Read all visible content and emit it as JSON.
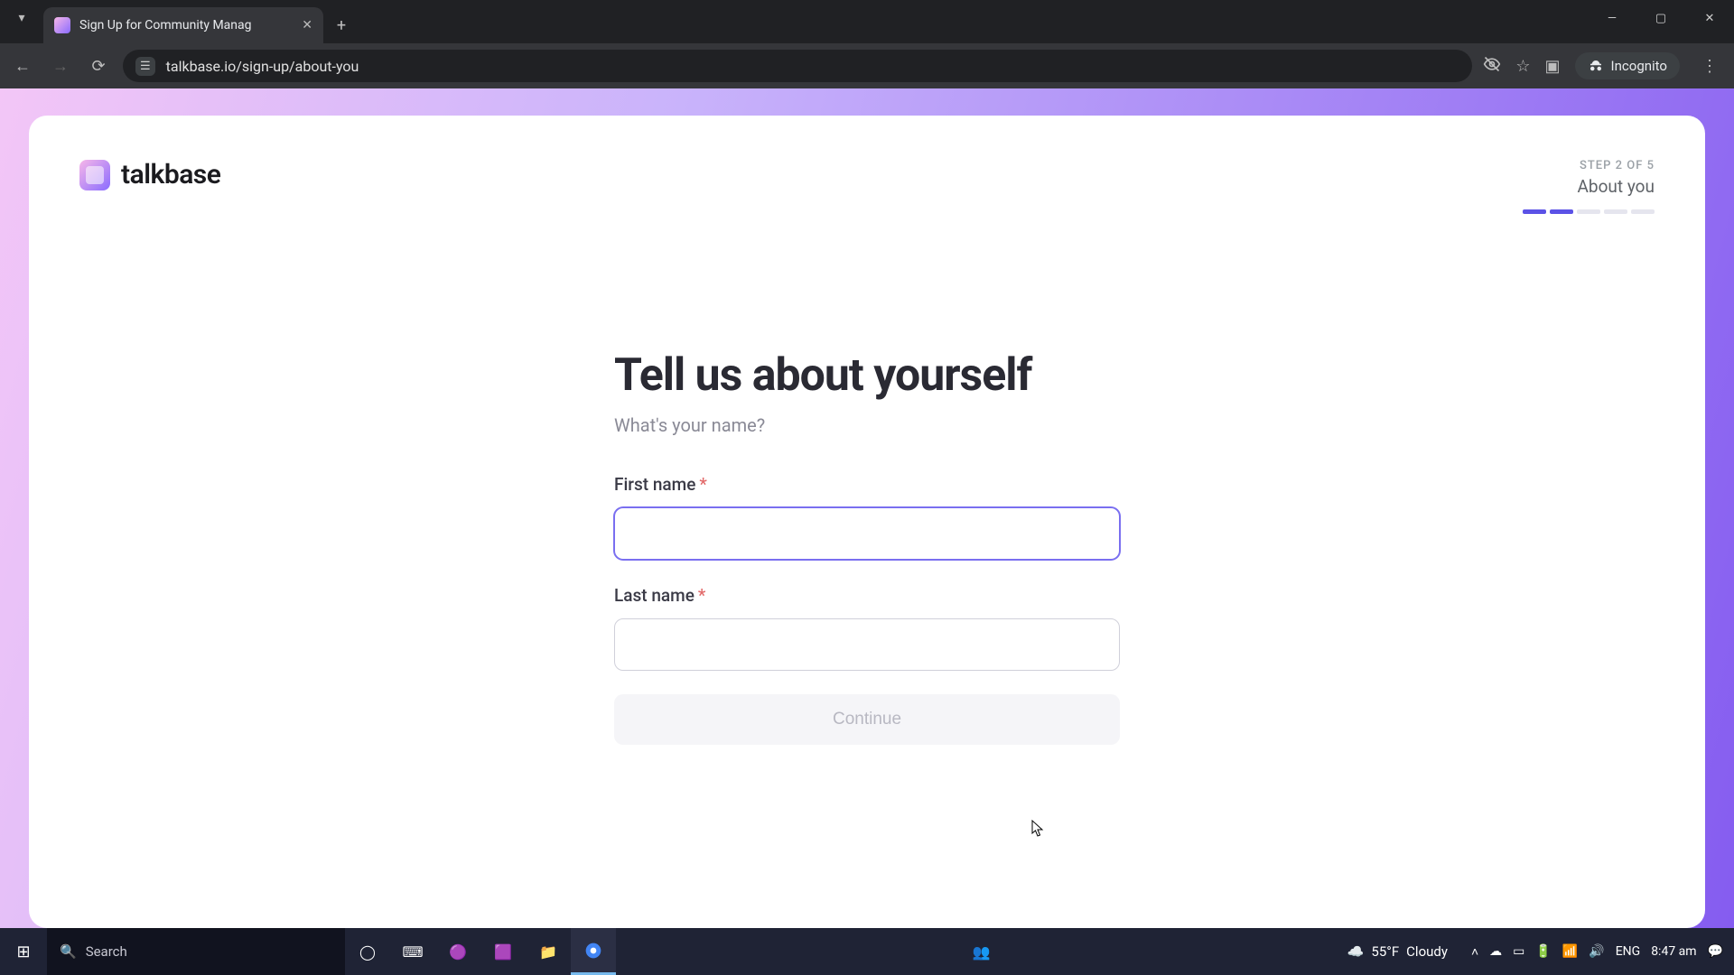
{
  "browser": {
    "tab_title": "Sign Up for Community Manag",
    "url": "talkbase.io/sign-up/about-you",
    "incognito_label": "Incognito"
  },
  "app": {
    "brand": "talkbase",
    "step_label": "STEP 2 OF 5",
    "step_name": "About you",
    "progress": {
      "current": 2,
      "total": 5
    }
  },
  "form": {
    "heading": "Tell us about yourself",
    "subheading": "What's your name?",
    "first_name": {
      "label": "First name",
      "value": ""
    },
    "last_name": {
      "label": "Last name",
      "value": ""
    },
    "continue_label": "Continue"
  },
  "taskbar": {
    "search_placeholder": "Search",
    "weather_temp": "55°F",
    "weather_cond": "Cloudy",
    "lang": "ENG",
    "time": "8:47 am"
  }
}
